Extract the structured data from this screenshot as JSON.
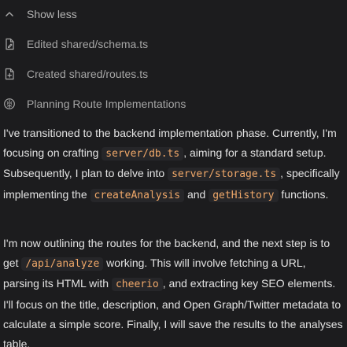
{
  "steps": {
    "toggle": {
      "label": "Show less",
      "icon": "chevron-up-icon"
    },
    "items": [
      {
        "label": "Edited shared/schema.ts",
        "icon": "file-edit-icon"
      },
      {
        "label": "Created shared/routes.ts",
        "icon": "file-plus-icon"
      },
      {
        "label": "Planning Route Implementations",
        "icon": "brain-icon"
      }
    ]
  },
  "message": {
    "p1": {
      "t1": "I've transitioned to the backend implementation phase. Currently, I'm focusing on crafting ",
      "c1": "server/db.ts",
      "t2": ", aiming for a standard setup. Subsequently, I plan to delve into ",
      "c2": "server/storage.ts",
      "t3": ", specifically implementing the ",
      "c3": "createAnalysis",
      "t4": " and ",
      "c4": "getHistory",
      "t5": " functions."
    },
    "p2": {
      "t1": "I'm now outlining the routes for the backend, and the next step is to get ",
      "c1": "/api/analyze",
      "t2": " working. This will involve fetching a URL, parsing its HTML with ",
      "c2": "cheerio",
      "t3": ", and extracting key SEO elements. I'll focus on the title, description, and Open Graph/Twitter metadata to calculate a simple score. Finally, I will save the results to the analyses table."
    }
  },
  "colors": {
    "background": "#1c1c1e",
    "code_text": "#f0a869",
    "code_bg": "#262629",
    "muted_text": "#a6a6a6",
    "body_text": "#e2e2e2"
  }
}
